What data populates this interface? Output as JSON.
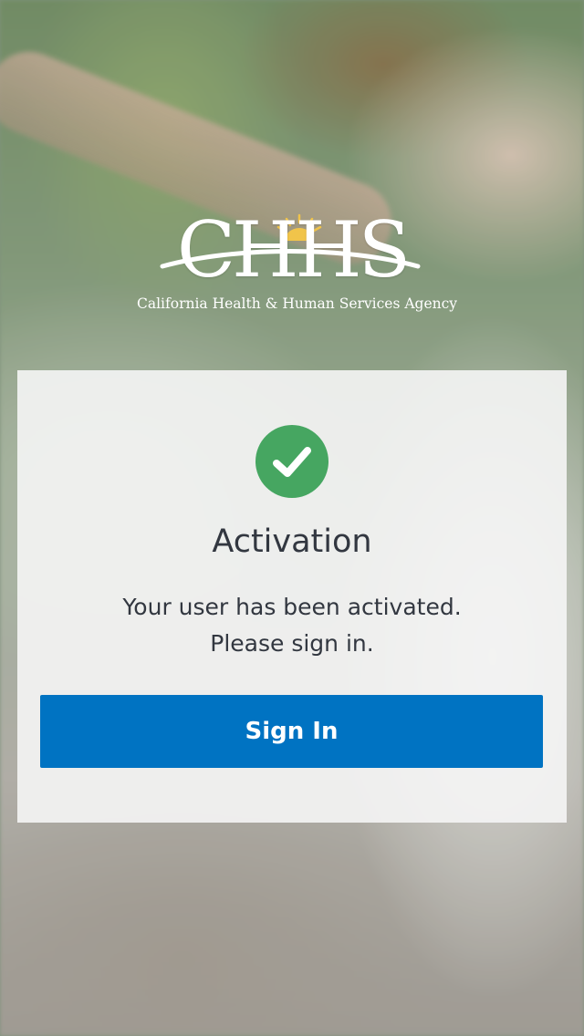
{
  "logo": {
    "letters": "CHHS",
    "tagline": "California Health & Human Services Agency",
    "icon": "sun-icon"
  },
  "card": {
    "status_icon": "checkmark-icon",
    "title": "Activation",
    "message_line1": "Your user has been activated.",
    "message_line2": "Please sign in.",
    "signin_label": "Sign In"
  },
  "colors": {
    "primary_button": "#0073c2",
    "success": "#46a661",
    "text": "#323740",
    "sun": "#f1c44a"
  }
}
